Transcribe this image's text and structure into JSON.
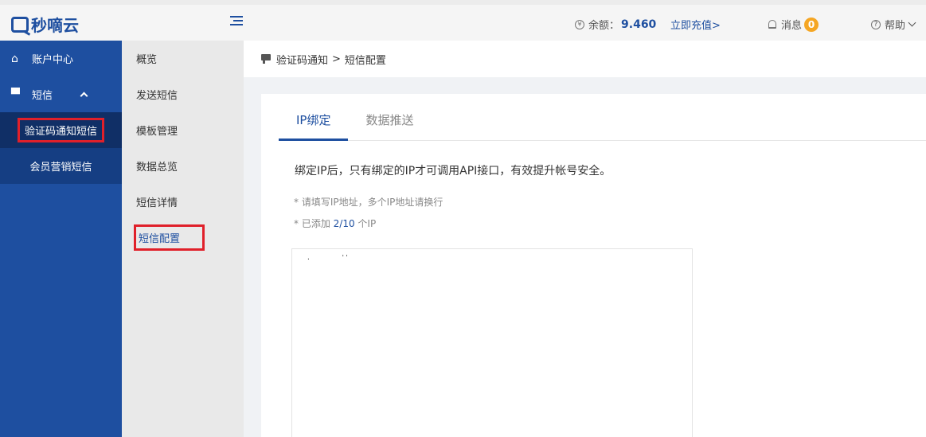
{
  "header": {
    "logo_text": "秒嘀云",
    "balance_label": "余额：",
    "balance_value": "9.460",
    "recharge_label": "立即充值>",
    "messages_label": "消息",
    "messages_count": "0",
    "help_label": "帮助"
  },
  "sidebar": {
    "items": [
      {
        "label": "账户中心"
      },
      {
        "label": "短信"
      }
    ],
    "sub_items": [
      {
        "label": "验证码通知短信"
      },
      {
        "label": "会员营销短信"
      }
    ]
  },
  "menu2": {
    "items": [
      {
        "label": "概览"
      },
      {
        "label": "发送短信"
      },
      {
        "label": "模板管理"
      },
      {
        "label": "数据总览"
      },
      {
        "label": "短信详情"
      },
      {
        "label": "短信配置"
      }
    ]
  },
  "breadcrumb": {
    "parent": "验证码通知",
    "separator": ">",
    "current": "短信配置"
  },
  "tabs": [
    {
      "label": "IP绑定"
    },
    {
      "label": "数据推送"
    }
  ],
  "content": {
    "description": "绑定IP后，只有绑定的IP才可调用API接口，有效提升帐号安全。",
    "note1": "* 请填写IP地址，多个IP地址请换行",
    "note2_prefix": "* 已添加 ",
    "note2_count": "2/10",
    "note2_suffix": " 个IP",
    "ip_list_value": ".        ''"
  },
  "colors": {
    "brand": "#1e4fa0",
    "highlight_box": "#e0202a",
    "badge": "#f5a623"
  }
}
